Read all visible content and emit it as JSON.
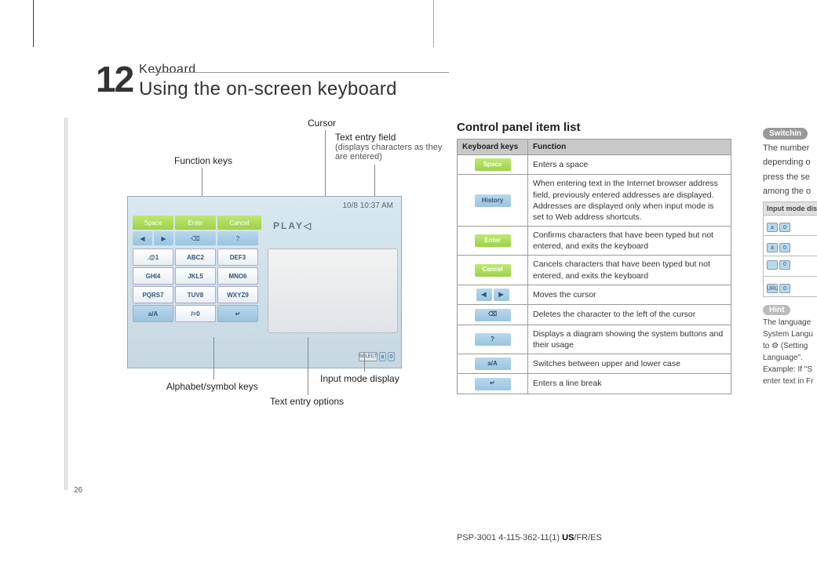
{
  "chapter": {
    "number": "12",
    "subtitle": "Keyboard",
    "title": "Using the on-screen keyboard"
  },
  "callouts": {
    "cursor": "Cursor",
    "text_entry_field": "Text entry field",
    "text_entry_sub": "(displays characters as they are entered)",
    "function_keys": "Function keys",
    "alphabet_keys": "Alphabet/symbol keys",
    "text_entry_options": "Text entry options",
    "input_mode": "Input mode display"
  },
  "screenshot": {
    "status": "10/8 10:37 AM",
    "play_text": "PLAY",
    "cursor_glyph": "◁",
    "fnkeys": [
      "Space",
      "Enter",
      "Cancel"
    ],
    "fnrow2": [
      "◀",
      "▶",
      "⌫",
      "?"
    ],
    "keys": [
      ".@1",
      "ABC2",
      "DEF3",
      "GHI4",
      "JKL5",
      "MNO6",
      "PQRS7",
      "TUV8",
      "WXYZ9",
      "a/A",
      "/=0",
      "↵"
    ],
    "mode": {
      "select": "SELECT",
      "a": "a",
      "n": "0"
    }
  },
  "ctrl": {
    "title": "Control panel item list",
    "head_keys": "Keyboard keys",
    "head_fn": "Function",
    "rows": [
      {
        "icon": "Space",
        "ico_class": "ico-green",
        "fn": "Enters a space"
      },
      {
        "icon": "History",
        "ico_class": "ico-blue",
        "fn": "When entering text in the Internet browser address field, previously entered addresses are displayed. Addresses are displayed only when input mode is set to Web address shortcuts."
      },
      {
        "icon": "Enter",
        "ico_class": "ico-green",
        "fn": "Confirms characters that have been typed but not entered, and exits the keyboard"
      },
      {
        "icon": "Cancel",
        "ico_class": "ico-green",
        "fn": "Cancels characters that have been typed but not entered, and exits the keyboard"
      },
      {
        "icon_pair": [
          "◀",
          "▶"
        ],
        "ico_class": "ico-blue",
        "fn": "Moves the cursor"
      },
      {
        "icon": "⌫",
        "ico_class": "ico-blue",
        "fn": "Deletes the character to the left of the cursor"
      },
      {
        "icon": "?",
        "ico_class": "ico-blue",
        "fn": "Displays a diagram showing the system buttons and their usage"
      },
      {
        "icon": "a/A",
        "ico_class": "ico-blue",
        "fn": "Switches between upper and lower case"
      },
      {
        "icon": "↵",
        "ico_class": "ico-blue",
        "fn": "Enters a line break"
      }
    ]
  },
  "right": {
    "pill": "Switchin",
    "p1": "The number",
    "p2": "depending o",
    "p3": "press the se",
    "p4": "among the o",
    "table_head": "Input mode display",
    "modes": [
      [
        "a",
        "0"
      ],
      [
        "á",
        "0"
      ],
      [
        "",
        "0"
      ],
      [
        "URL",
        "0"
      ]
    ],
    "hint": "Hint",
    "hint_lines": [
      "The language",
      "System Langu",
      "to ⚙ (Setting",
      "Language\".",
      "Example:  If \"S",
      "enter text in Fr"
    ]
  },
  "page_num": "26",
  "footer": {
    "code": "PSP-3001 4-115-362-11(1) ",
    "us": "US",
    "rest": "/FR/ES"
  }
}
